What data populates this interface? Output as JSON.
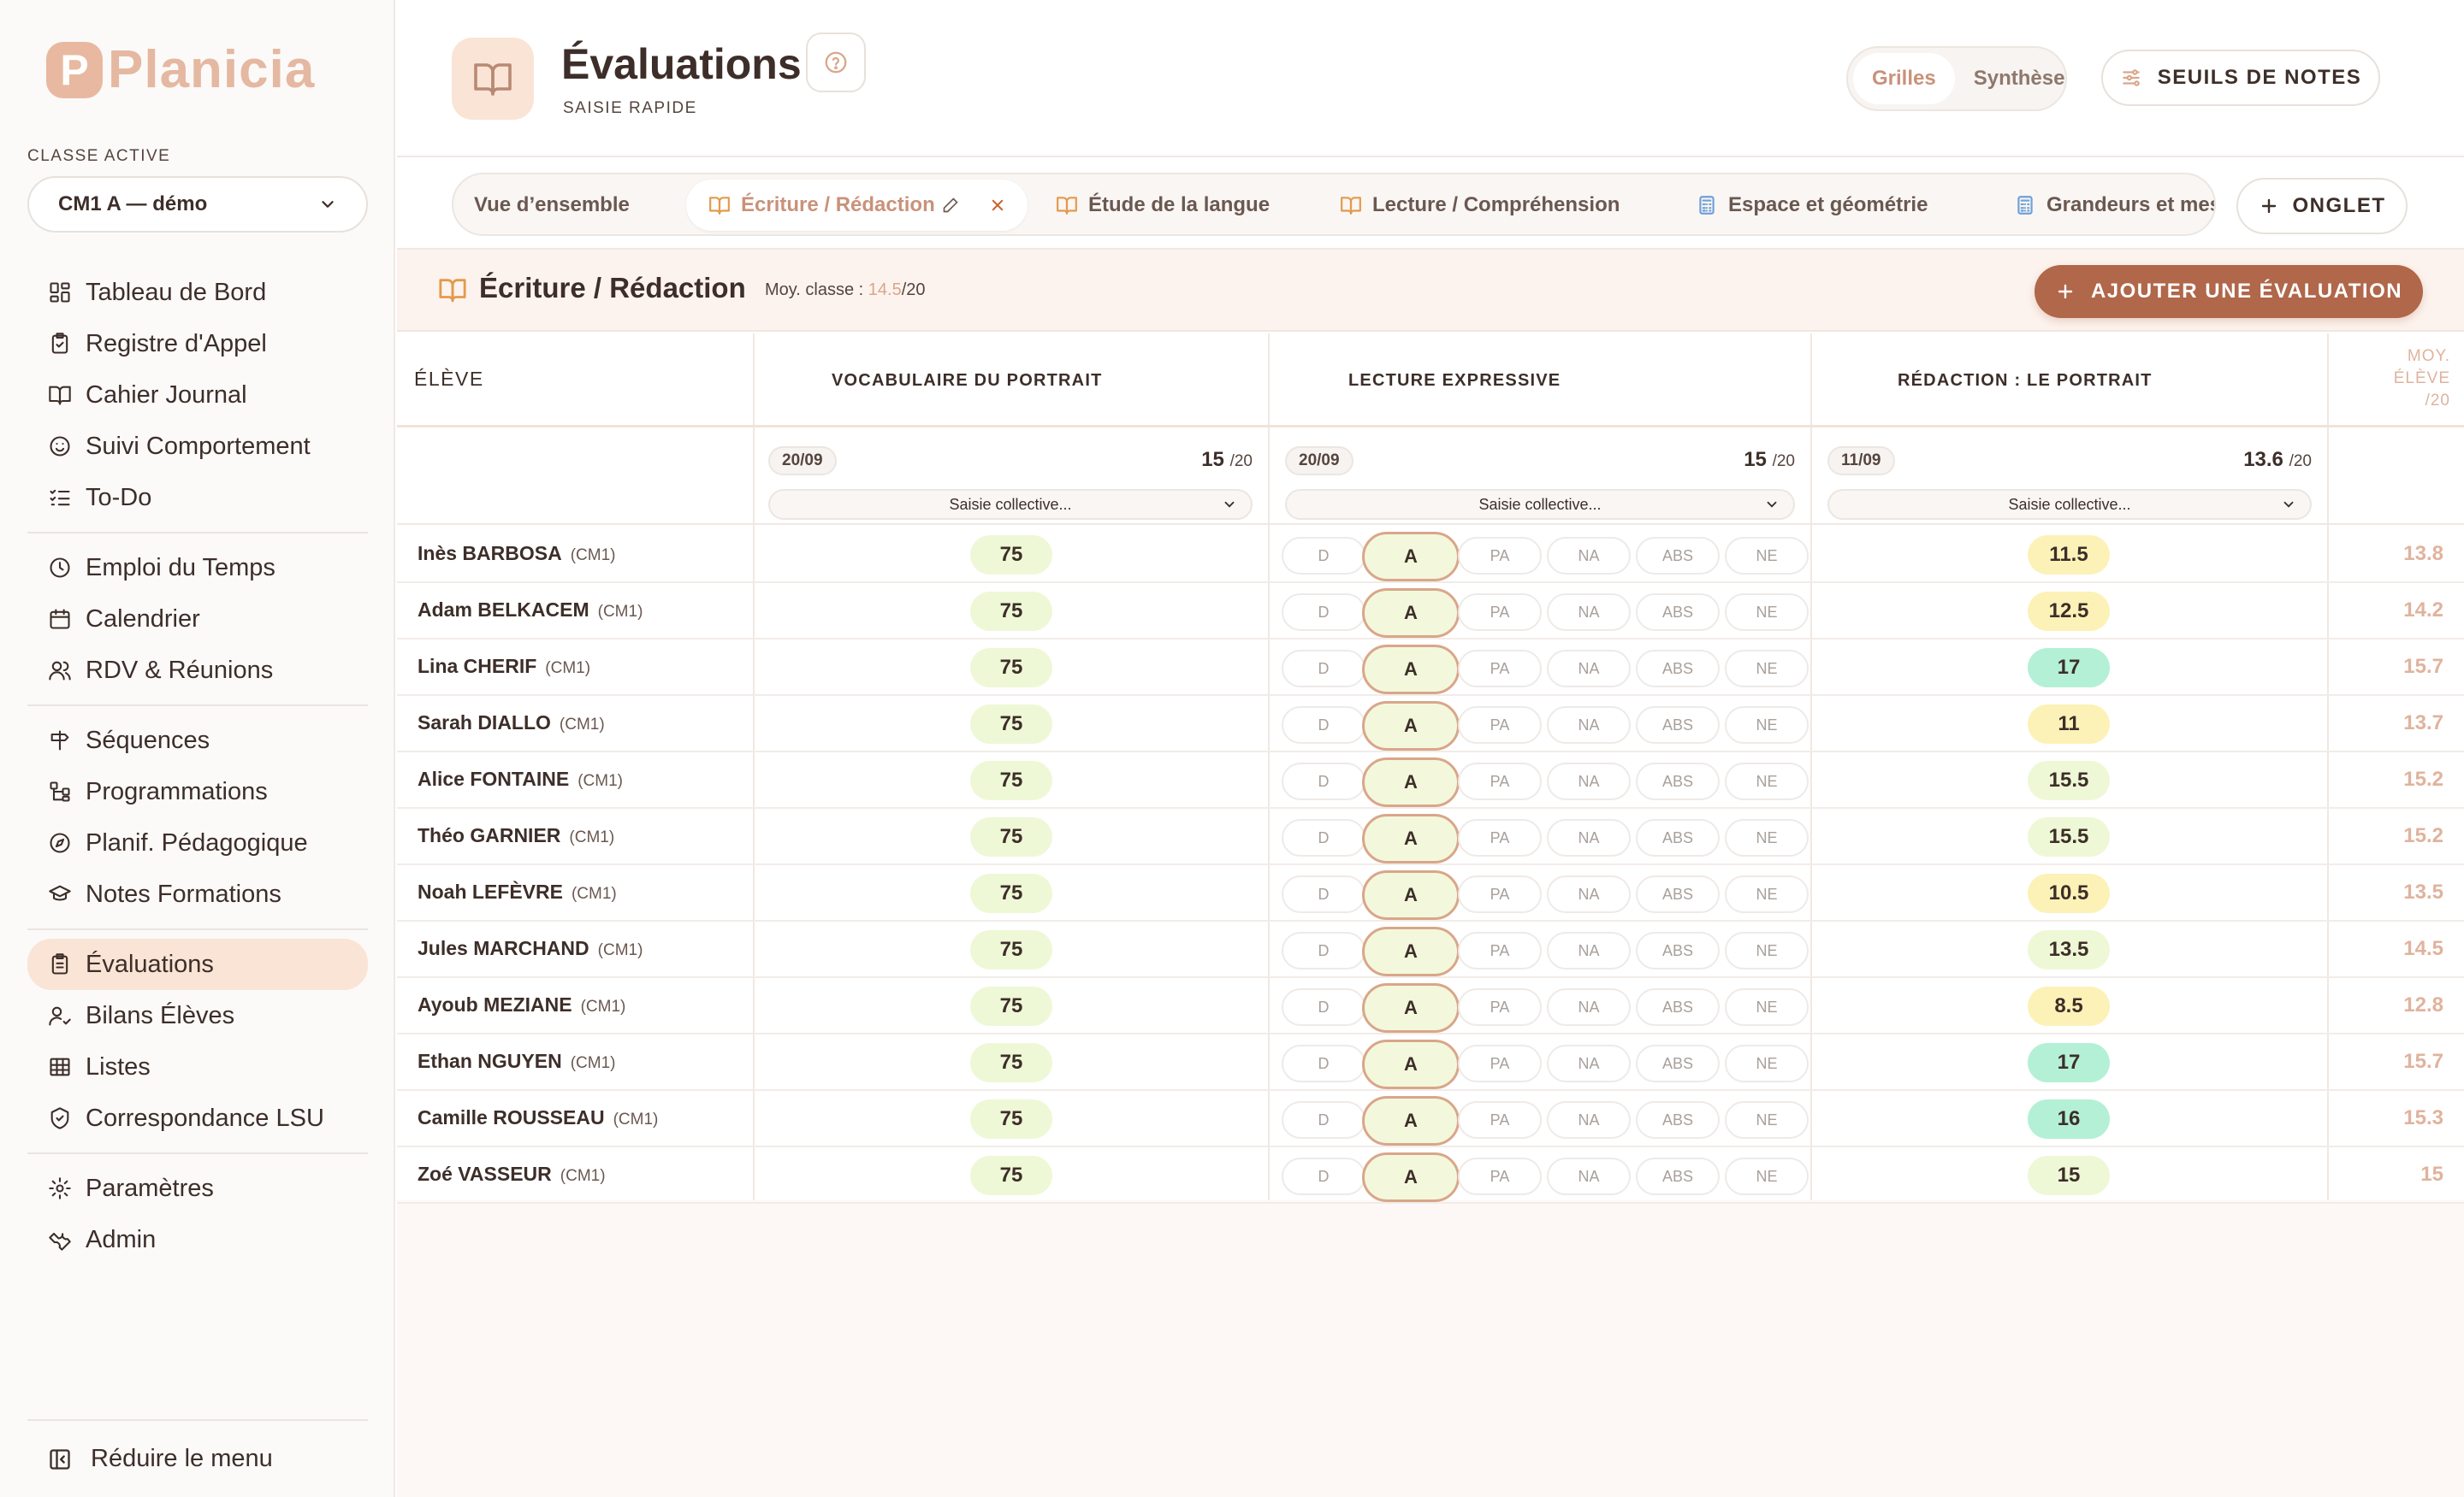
{
  "app": {
    "logo_letter": "P",
    "name": "Planicia"
  },
  "sidebar": {
    "class_label": "CLASSE ACTIVE",
    "class_value": "CM1 A — démo",
    "groups": [
      [
        {
          "label": "Tableau de Bord",
          "icon": "dashboard-icon"
        },
        {
          "label": "Registre d'Appel",
          "icon": "clipboard-check-icon"
        },
        {
          "label": "Cahier Journal",
          "icon": "open-book-icon"
        },
        {
          "label": "Suivi Comportement",
          "icon": "smiley-icon"
        },
        {
          "label": "To-Do",
          "icon": "checklist-icon"
        }
      ],
      [
        {
          "label": "Emploi du Temps",
          "icon": "clock-icon"
        },
        {
          "label": "Calendrier",
          "icon": "calendar-icon"
        },
        {
          "label": "RDV & Réunions",
          "icon": "users-icon"
        }
      ],
      [
        {
          "label": "Séquences",
          "icon": "signpost-icon"
        },
        {
          "label": "Programmations",
          "icon": "tree-icon"
        },
        {
          "label": "Planif. Pédagogique",
          "icon": "compass-icon"
        },
        {
          "label": "Notes Formations",
          "icon": "graduation-cap-icon"
        }
      ],
      [
        {
          "label": "Évaluations",
          "icon": "clipboard-list-icon",
          "active": true
        },
        {
          "label": "Bilans Élèves",
          "icon": "user-check-icon"
        },
        {
          "label": "Listes",
          "icon": "table-icon"
        },
        {
          "label": "Correspondance LSU",
          "icon": "shield-check-icon"
        }
      ],
      [
        {
          "label": "Paramètres",
          "icon": "gear-icon"
        },
        {
          "label": "Admin",
          "icon": "wrench-icon"
        }
      ]
    ],
    "reduce_label": "Réduire le menu"
  },
  "header": {
    "title": "Évaluations",
    "subtitle": "SAISIE RAPIDE",
    "view_toggle": [
      "Grilles",
      "Synthèse"
    ],
    "active_view": "Grilles",
    "seuils_label": "SEUILS DE NOTES"
  },
  "tabs": {
    "items": [
      {
        "label": "Vue d’ensemble",
        "icon": ""
      },
      {
        "label": "Écriture / Rédaction",
        "icon": "book-icon",
        "active": true
      },
      {
        "label": "Étude de la langue",
        "icon": "book-icon"
      },
      {
        "label": "Lecture / Compréhension",
        "icon": "book-icon"
      },
      {
        "label": "Espace et géométrie",
        "icon": "calculator-icon"
      },
      {
        "label": "Grandeurs et mesures",
        "icon": "calculator-icon"
      }
    ],
    "add_label": "ONGLET"
  },
  "section": {
    "title": "Écriture / Rédaction",
    "avg_prefix": "Moy. classe : ",
    "avg_value": "14.5",
    "avg_suffix": "/20",
    "add_button": "AJOUTER UNE ÉVALUATION"
  },
  "table": {
    "student_header": "ÉLÈVE",
    "moy_header": [
      "MOY.",
      "ÉLÈVE",
      "/20"
    ],
    "evaluations": [
      {
        "title": "VOCABULAIRE DU PORTRAIT",
        "date": "20/09",
        "score": "15",
        "out_of": "/20",
        "collective": "Saisie collective..."
      },
      {
        "title": "LECTURE EXPRESSIVE",
        "date": "20/09",
        "score": "15",
        "out_of": "/20",
        "collective": "Saisie collective..."
      },
      {
        "title": "RÉDACTION : LE PORTRAIT",
        "date": "11/09",
        "score": "13.6",
        "out_of": "/20",
        "collective": "Saisie collective..."
      }
    ],
    "levels": [
      "D",
      "A",
      "PA",
      "NA",
      "ABS",
      "NE"
    ],
    "colors": {
      "green_pill": "#eef8d6",
      "yellow_pill": "#fcf2b8",
      "mint_pill": "#b4f0d6",
      "accent": "#c9927a",
      "button": "#b0674a"
    },
    "rows": [
      {
        "name": "Inès BARBOSA",
        "class": "(CM1)",
        "e1": "75",
        "e2": "A",
        "e3": "11.5",
        "e3_color": "yellow",
        "moy": "13.8"
      },
      {
        "name": "Adam BELKACEM",
        "class": "(CM1)",
        "e1": "75",
        "e2": "A",
        "e3": "12.5",
        "e3_color": "yellow",
        "moy": "14.2"
      },
      {
        "name": "Lina CHERIF",
        "class": "(CM1)",
        "e1": "75",
        "e2": "A",
        "e3": "17",
        "e3_color": "mint",
        "moy": "15.7"
      },
      {
        "name": "Sarah DIALLO",
        "class": "(CM1)",
        "e1": "75",
        "e2": "A",
        "e3": "11",
        "e3_color": "yellow",
        "moy": "13.7"
      },
      {
        "name": "Alice FONTAINE",
        "class": "(CM1)",
        "e1": "75",
        "e2": "A",
        "e3": "15.5",
        "e3_color": "green",
        "moy": "15.2"
      },
      {
        "name": "Théo GARNIER",
        "class": "(CM1)",
        "e1": "75",
        "e2": "A",
        "e3": "15.5",
        "e3_color": "green",
        "moy": "15.2"
      },
      {
        "name": "Noah LEFÈVRE",
        "class": "(CM1)",
        "e1": "75",
        "e2": "A",
        "e3": "10.5",
        "e3_color": "yellow",
        "moy": "13.5"
      },
      {
        "name": "Jules MARCHAND",
        "class": "(CM1)",
        "e1": "75",
        "e2": "A",
        "e3": "13.5",
        "e3_color": "green",
        "moy": "14.5"
      },
      {
        "name": "Ayoub MEZIANE",
        "class": "(CM1)",
        "e1": "75",
        "e2": "A",
        "e3": "8.5",
        "e3_color": "yellow",
        "moy": "12.8"
      },
      {
        "name": "Ethan NGUYEN",
        "class": "(CM1)",
        "e1": "75",
        "e2": "A",
        "e3": "17",
        "e3_color": "mint",
        "moy": "15.7"
      },
      {
        "name": "Camille ROUSSEAU",
        "class": "(CM1)",
        "e1": "75",
        "e2": "A",
        "e3": "16",
        "e3_color": "mint",
        "moy": "15.3"
      },
      {
        "name": "Zoé VASSEUR",
        "class": "(CM1)",
        "e1": "75",
        "e2": "A",
        "e3": "15",
        "e3_color": "green",
        "moy": "15"
      }
    ]
  }
}
